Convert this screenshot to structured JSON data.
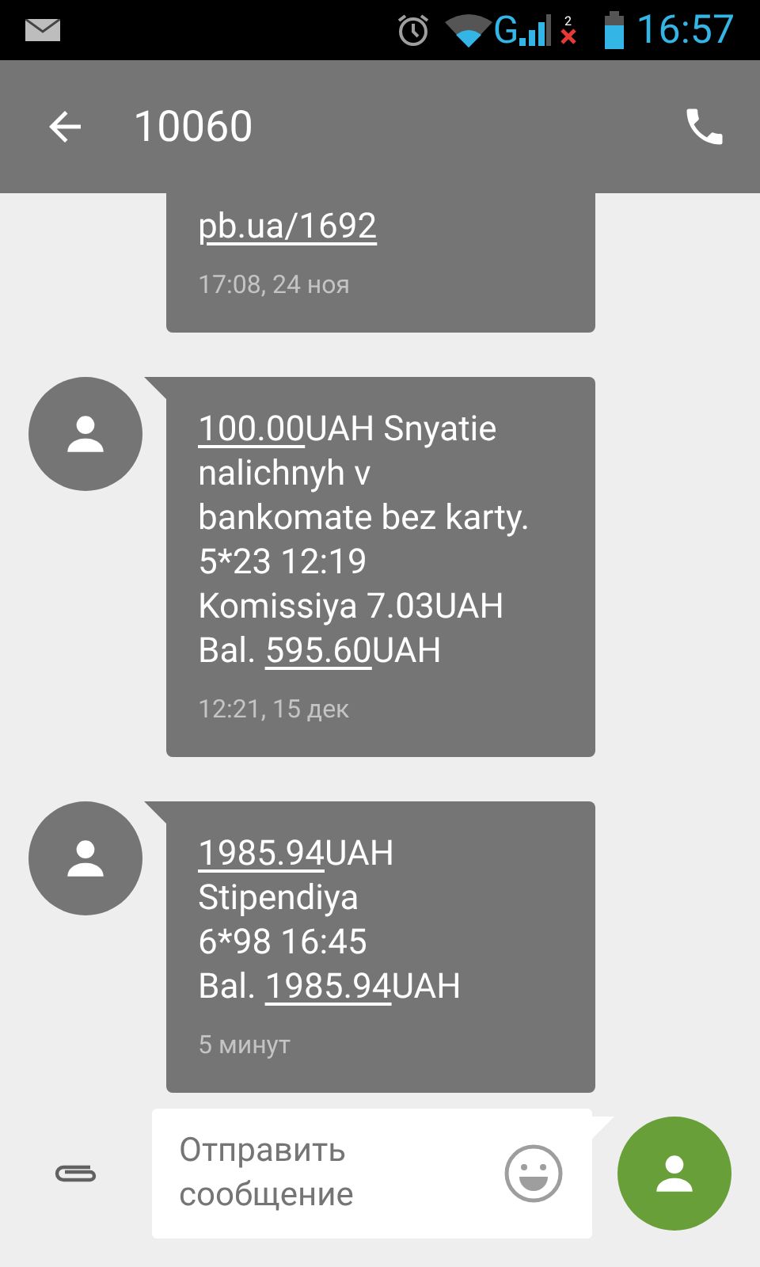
{
  "status_bar": {
    "network": "G",
    "sim_slot": "2",
    "time": "16:57"
  },
  "app_bar": {
    "title": "10060"
  },
  "messages": [
    {
      "avatar": false,
      "lines": [
        [
          {
            "text": "pb.ua/1692",
            "link": true
          }
        ]
      ],
      "time": "17:08, 24 ноя"
    },
    {
      "avatar": true,
      "lines": [
        [
          {
            "text": "100.00",
            "link": true
          },
          {
            "text": "UAH Snyatie",
            "link": false
          }
        ],
        [
          {
            "text": "nalichnyh v",
            "link": false
          }
        ],
        [
          {
            "text": "bankomate bez karty.",
            "link": false
          }
        ],
        [
          {
            "text": "5*23 12:19",
            "link": false
          }
        ],
        [
          {
            "text": "Komissiya 7.03UAH",
            "link": false
          }
        ],
        [
          {
            "text": "Bal. ",
            "link": false
          },
          {
            "text": "595.60",
            "link": true
          },
          {
            "text": "UAH",
            "link": false
          }
        ]
      ],
      "time": "12:21, 15 дек"
    },
    {
      "avatar": true,
      "lines": [
        [
          {
            "text": "1985.94",
            "link": true
          },
          {
            "text": "UAH",
            "link": false
          }
        ],
        [
          {
            "text": "Stipendiya",
            "link": false
          }
        ],
        [
          {
            "text": "6*98 16:45",
            "link": false
          }
        ],
        [
          {
            "text": "Bal. ",
            "link": false
          },
          {
            "text": "1985.94",
            "link": true
          },
          {
            "text": "UAH",
            "link": false
          }
        ]
      ],
      "time": "5 минут"
    }
  ],
  "composer": {
    "placeholder": "Отправить сообщение"
  }
}
